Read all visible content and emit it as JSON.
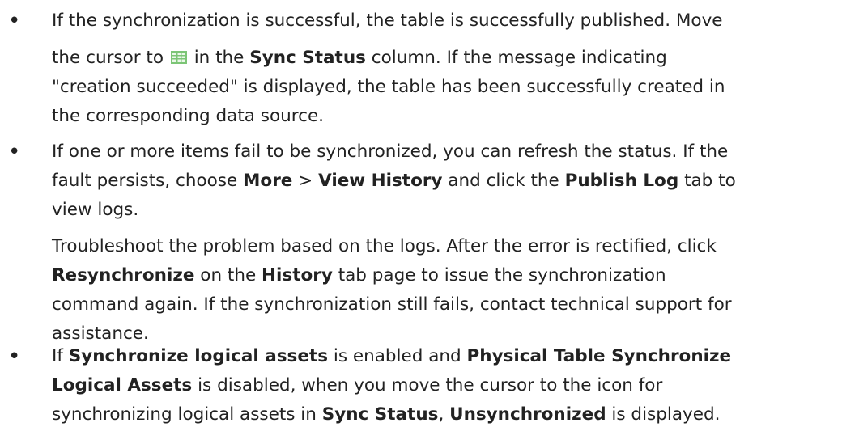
{
  "bullet_char": "•",
  "items": [
    {
      "lines": [
        [
          "If the synchronization is successful, the table is successfully published. Move"
        ],
        [
          "the cursor to ",
          {
            "icon": "table-grid-icon"
          },
          " in the ",
          {
            "b": "Sync Status"
          },
          " column. If the message indicating"
        ],
        [
          "\"creation succeeded\" is displayed, the table has been successfully created in"
        ],
        [
          "the corresponding data source."
        ]
      ]
    },
    {
      "lines": [
        [
          "If one or more items fail to be synchronized, you can refresh the status. If the"
        ],
        [
          "fault persists, choose ",
          {
            "b": "More"
          },
          " > ",
          {
            "b": "View History"
          },
          " and click the ",
          {
            "b": "Publish Log"
          },
          " tab to"
        ],
        [
          "view logs."
        ]
      ],
      "para": [
        [
          {
            "b": "Resynchronize"
          },
          ""
        ],
        [
          "Troubleshoot the problem based on the logs. After the error is rectified, click"
        ],
        [
          {
            "b": "Resynchronize"
          },
          " on the ",
          {
            "b": "History"
          },
          " tab page to issue the synchronization"
        ],
        [
          "command again. If the synchronization still fails, contact technical support for"
        ],
        [
          "assistance."
        ]
      ]
    },
    {
      "lines": [
        [
          "If ",
          {
            "b": "Synchronize logical assets"
          },
          " is enabled and ",
          {
            "b": "Physical Table Synchronize"
          }
        ],
        [
          {
            "b": "Logical Assets"
          },
          " is disabled, when you move the cursor to the icon for"
        ],
        [
          "synchronizing logical assets in ",
          {
            "b": "Sync Status"
          },
          ", ",
          {
            "b": "Unsynchronized"
          },
          " is displayed."
        ]
      ]
    }
  ]
}
